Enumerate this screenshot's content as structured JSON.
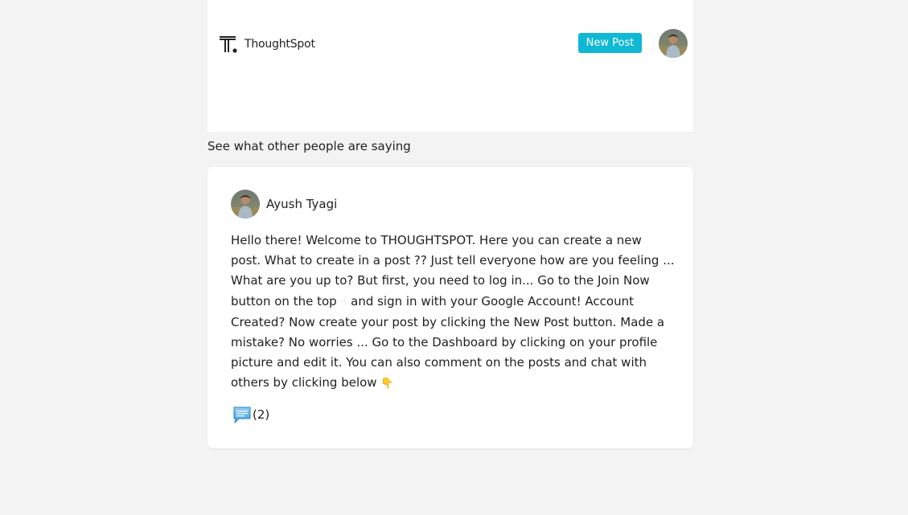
{
  "header": {
    "brand": "ThoughtSpot",
    "new_post_label": "New Post"
  },
  "feed": {
    "heading": "See what other people are saying"
  },
  "post": {
    "author": "Ayush Tyagi",
    "body_part1": "Hello there! Welcome to THOUGHTSPOT. Here you can create a new post. What to create in a post ?? Just tell everyone how are you feeling ... What are you up to? But first, you need to log in... Go to the Join Now button on the top ",
    "emoji_up": "☝",
    "body_part2": " and sign in with your Google Account! Account Created? Now create your post by clicking the New Post button. Made a mistake? No worries ... Go to the Dashboard by clicking on your profile picture and edit it. You can also comment on the posts and chat with others by clicking below ",
    "emoji_down": "👇",
    "comment_count": "(2)"
  },
  "icons": {
    "logo": "thoughtspot-logo-icon",
    "comment": "speech-bubble-icon",
    "avatar": "user-avatar"
  },
  "colors": {
    "accent": "#0fb8d4",
    "background": "#f3f3f3",
    "card": "#ffffff"
  }
}
